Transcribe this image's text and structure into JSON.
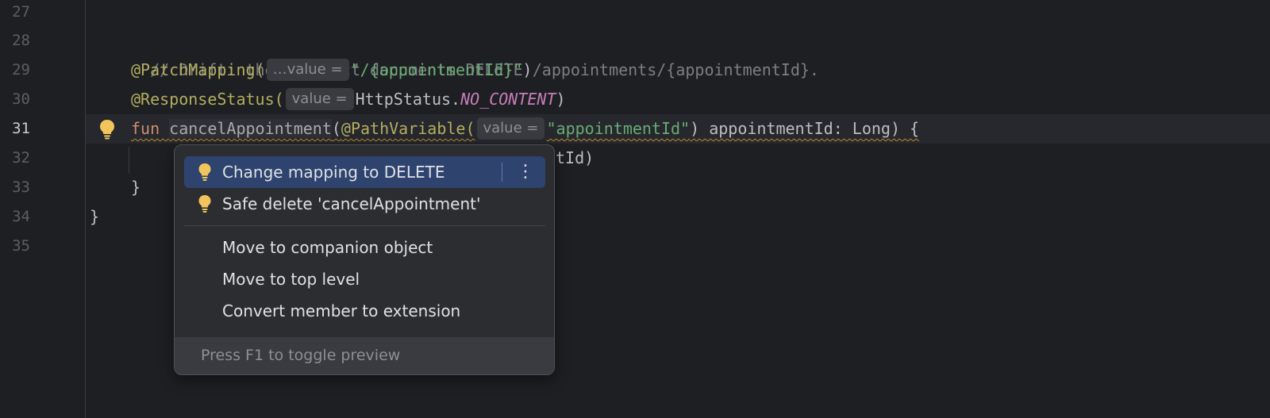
{
  "editor": {
    "line_numbers": [
      "27",
      "28",
      "29",
      "30",
      "31",
      "32",
      "33",
      "34",
      "35"
    ],
    "active_line": "31",
    "lines": {
      "l28_comment": "// Drift: the contract documents DELETE /appointments/{appointmentId}.",
      "l29_annotation": "@PatchMapping(",
      "l29_hint": "…value =",
      "l29_string": "\"/{appointmentId}\"",
      "l29_close": ")",
      "l30_annotation": "@ResponseStatus(",
      "l30_hint": "value =",
      "l30_plain": "HttpStatus.",
      "l30_const": "NO_CONTENT",
      "l30_close": ")",
      "l31_keyword": "fun ",
      "l31_name": "cancelAppointment",
      "l31_paren": "(",
      "l31_annotation": "@PathVariable(",
      "l31_hint": "value =",
      "l31_string": "\"appointmentId\"",
      "l31_rest": ") appointmentId: Long) {",
      "l32_visible": "tId)",
      "l33": "}",
      "l34": "}"
    }
  },
  "popup": {
    "items": [
      {
        "label": "Change mapping to DELETE",
        "icon": "lightbulb-icon"
      },
      {
        "label": "Safe delete 'cancelAppointment'",
        "icon": "lightbulb-icon"
      },
      {
        "label": "Move to companion object"
      },
      {
        "label": "Move to top level"
      },
      {
        "label": "Convert member to extension"
      }
    ],
    "more_glyph": "⋮",
    "footer": "Press F1 to toggle preview"
  },
  "colors": {
    "background": "#1e1f22",
    "selection": "#2e436e",
    "bulb": "#f2c55c"
  }
}
